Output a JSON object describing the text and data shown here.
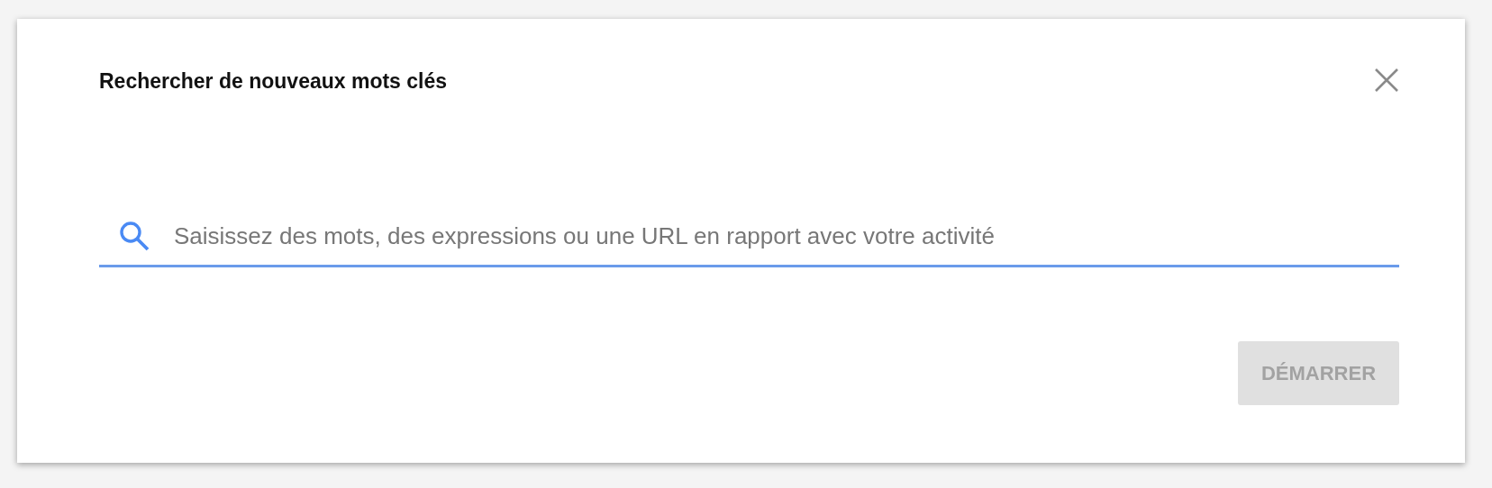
{
  "dialog": {
    "title": "Rechercher de nouveaux mots clés"
  },
  "search": {
    "placeholder": "Saisissez des mots, des expressions ou une URL en rapport avec votre activité",
    "focused": true
  },
  "button": {
    "label": "DÉMARRER",
    "disabled": true
  }
}
